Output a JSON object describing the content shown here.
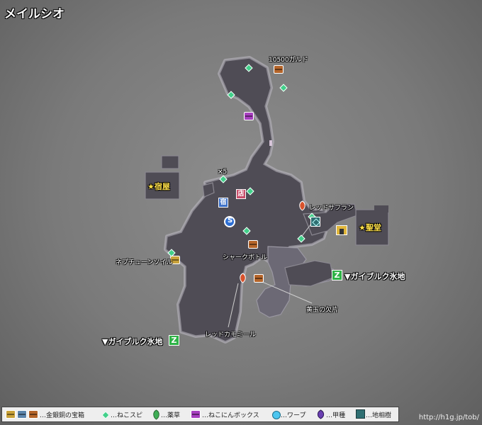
{
  "map_title": "メイルシオ",
  "buildings": {
    "inn": "★宿屋",
    "church": "★聖堂",
    "inn_sign": "宿",
    "shop_sign": "店"
  },
  "labels": {
    "gold_reward": "10500ガルド",
    "count": "×5",
    "red_saffron": "レッドサフラン",
    "shark_bottle": "シャークボトル",
    "neptune_oil": "ネプチューンソイル",
    "yellow_jade": "黄玉の欠片",
    "red_chamomile": "レッドカモミール",
    "exit_east": "▼ガイブルク氷地",
    "exit_southwest": "▼ガイブルク氷地",
    "save_point": "S"
  },
  "legend": {
    "chests": "…金銀銅の宝箱",
    "cat_seed": "…ねこスピ",
    "herb": "…薬草",
    "cat_box": "…ねこにんボックス",
    "warp": "…ワープ",
    "shell": "…甲種",
    "ley_tree": "…地相樹"
  },
  "site_url": "http://h1g.jp/tob/",
  "colors": {
    "floor": "#4f4c55",
    "floor_outline": "#8a8790",
    "upper_level": "#6c6975",
    "cat_seed": "#41d08a",
    "exit_icon": "#2fb347",
    "building_text": "#ffe14a"
  }
}
